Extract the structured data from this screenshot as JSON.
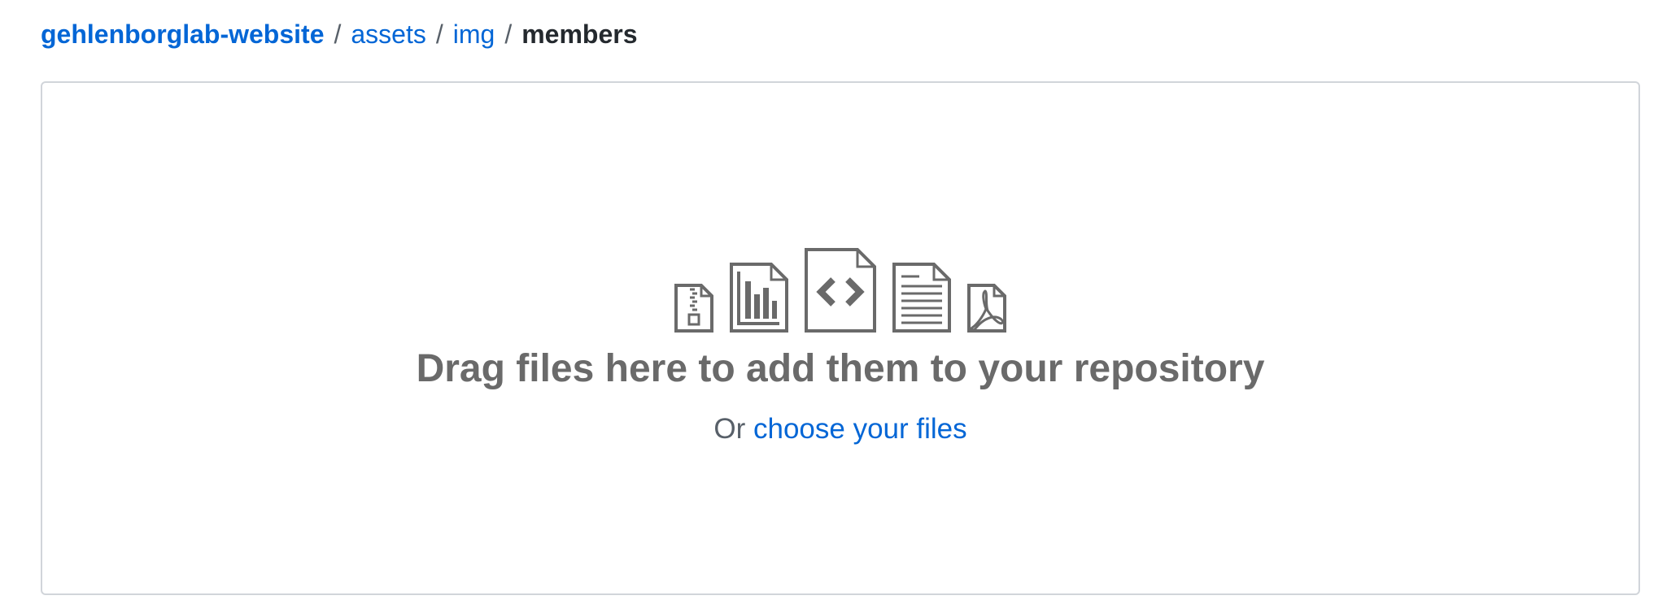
{
  "breadcrumb": {
    "repo": "gehlenborglab-website",
    "separator": "/",
    "folders": [
      "assets",
      "img"
    ],
    "current": "members"
  },
  "dropzone": {
    "icons": [
      "file-zip-icon",
      "file-media-chart-icon",
      "file-code-icon",
      "file-text-icon",
      "file-pdf-icon"
    ],
    "headline": "Drag files here to add them to your repository",
    "or_text": "Or",
    "choose_link": "choose your files"
  },
  "colors": {
    "link": "#0366d6",
    "icon": "#6a6a6a",
    "border": "#d1d5da"
  }
}
